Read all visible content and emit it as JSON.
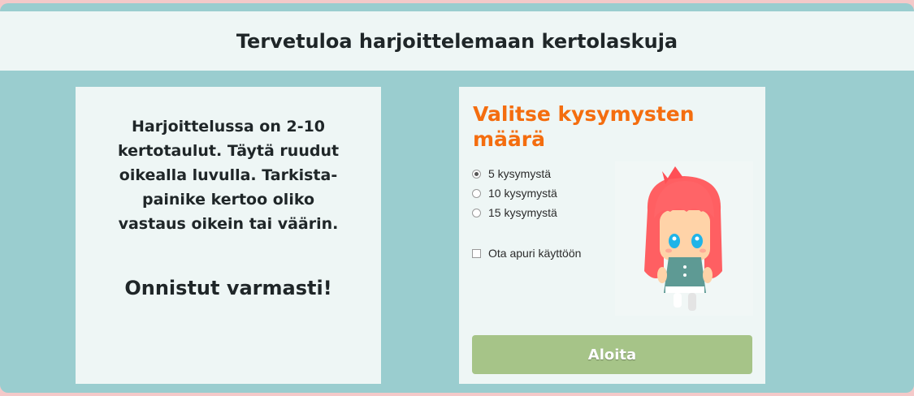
{
  "header": {
    "title": "Tervetuloa harjoittelemaan kertolaskuja"
  },
  "intro": {
    "lines": [
      "Harjoittelussa on 2-10",
      "kertotaulut. Täytä ruudut",
      "oikealla luvulla. Tarkista-",
      "painike kertoo oliko",
      "vastaus oikein tai väärin."
    ],
    "motto": "Onnistut varmasti!"
  },
  "settings": {
    "title": "Valitse kysymysten määrä",
    "options": [
      {
        "label": "5 kysymystä",
        "selected": true
      },
      {
        "label": "10 kysymystä",
        "selected": false
      },
      {
        "label": "15 kysymystä",
        "selected": false
      }
    ],
    "helper_label": "Ota apuri käyttöön",
    "helper_checked": false,
    "start_label": "Aloita",
    "illustration": "girl-character"
  },
  "colors": {
    "background": "#9acdcf",
    "panel": "#eef6f5",
    "accent": "#f46d0f",
    "button": "#a6c488"
  }
}
